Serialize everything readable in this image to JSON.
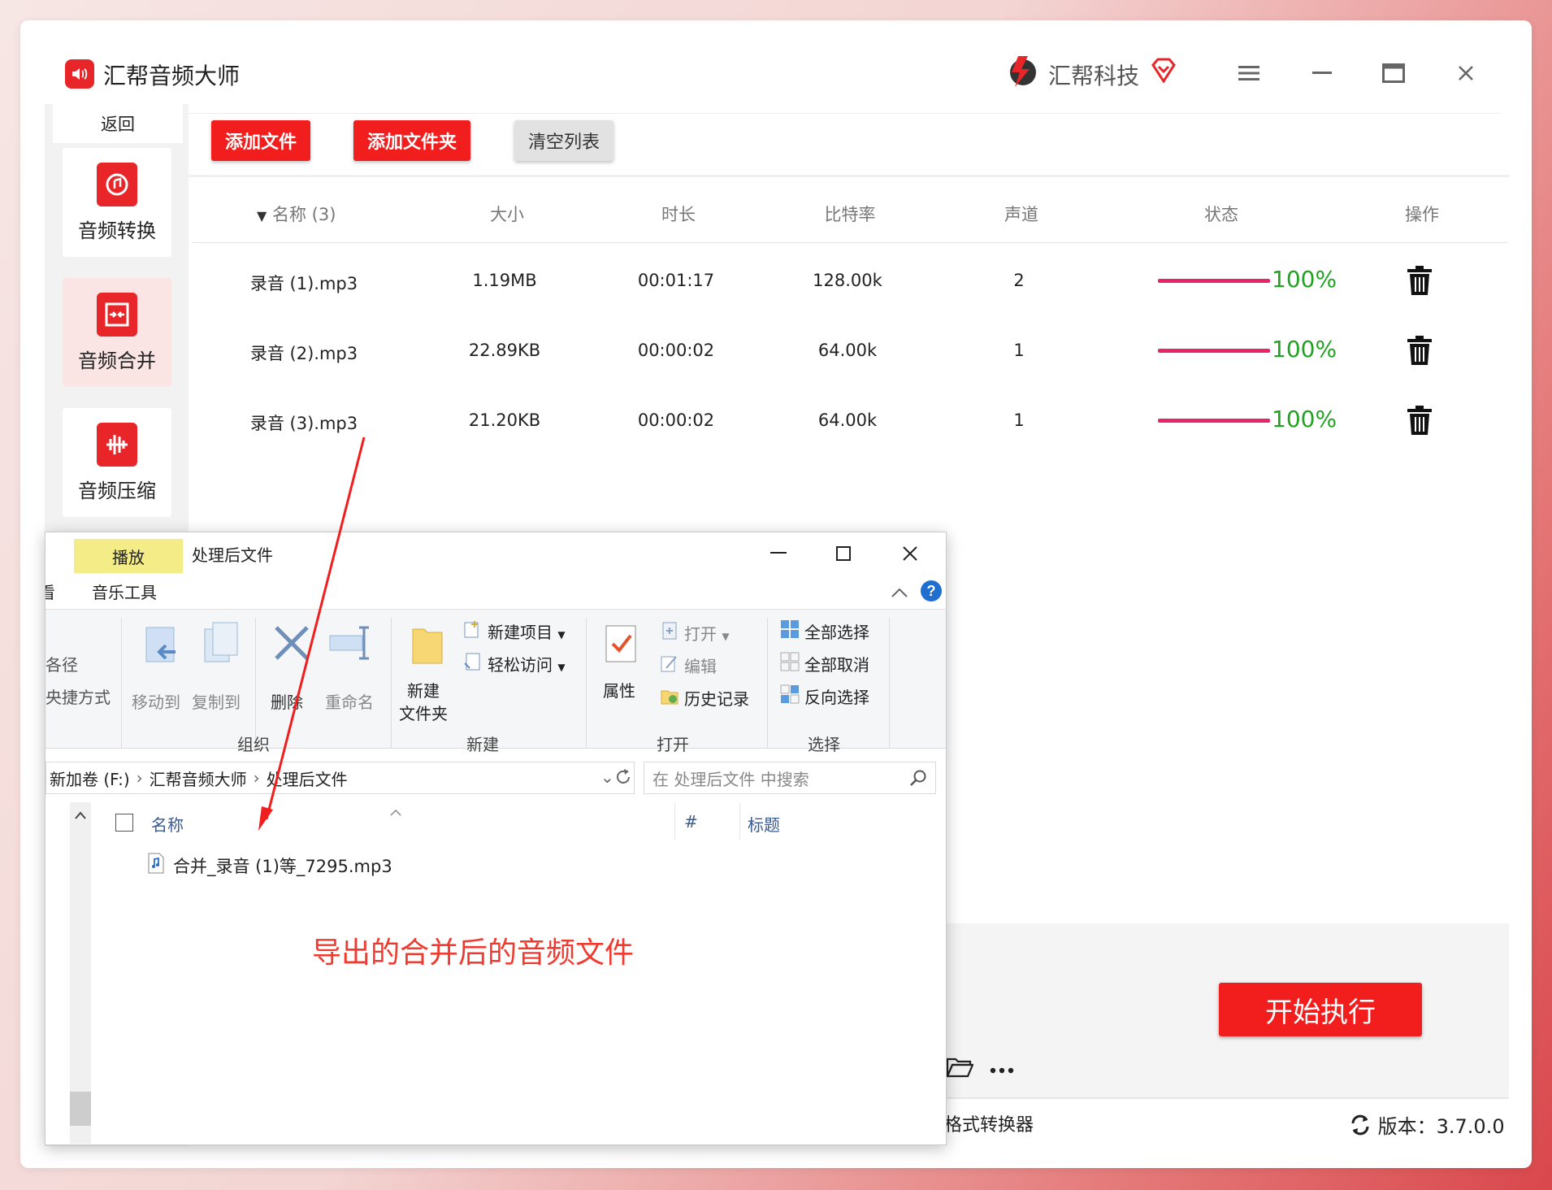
{
  "app": {
    "title": "汇帮音频大师",
    "brand": "汇帮科技",
    "back": "返回"
  },
  "sidebar": {
    "items": [
      {
        "label": "音频转换",
        "icon": "audio-convert-icon"
      },
      {
        "label": "音频合并",
        "icon": "audio-merge-icon"
      },
      {
        "label": "音频压缩",
        "icon": "audio-compress-icon"
      }
    ]
  },
  "toolbar": {
    "add_file": "添加文件",
    "add_folder": "添加文件夹",
    "clear_list": "清空列表"
  },
  "table": {
    "headers": {
      "name": "名称 (3)",
      "size": "大小",
      "duration": "时长",
      "bitrate": "比特率",
      "channels": "声道",
      "status": "状态",
      "action": "操作"
    },
    "rows": [
      {
        "name": "录音 (1).mp3",
        "size": "1.19MB",
        "duration": "00:01:17",
        "bitrate": "128.00k",
        "channels": "2",
        "progress": 100,
        "progress_label": "100%"
      },
      {
        "name": "录音 (2).mp3",
        "size": "22.89KB",
        "duration": "00:00:02",
        "bitrate": "64.00k",
        "channels": "1",
        "progress": 100,
        "progress_label": "100%"
      },
      {
        "name": "录音 (3).mp3",
        "size": "21.20KB",
        "duration": "00:00:02",
        "bitrate": "64.00k",
        "channels": "1",
        "progress": 100,
        "progress_label": "100%"
      }
    ]
  },
  "start_button": "开始执行",
  "footer": {
    "left": "格式转换器",
    "version": "版本：3.7.0.0"
  },
  "explorer": {
    "tab_play": "播放",
    "title": "处理后文件",
    "tab_music_tools": "音乐工具",
    "tab_partial": "看",
    "ribbon": {
      "path": "各径",
      "shortcut": "央捷方式",
      "move_to": "移动到",
      "copy_to": "复制到",
      "delete": "删除",
      "rename": "重命名",
      "group_organize": "组织",
      "new_folder_1": "新建",
      "new_folder_2": "文件夹",
      "new_item": "新建项目",
      "easy_access": "轻松访问",
      "group_new": "新建",
      "properties": "属性",
      "open": "打开",
      "edit": "编辑",
      "history": "历史记录",
      "group_open": "打开",
      "select_all": "全部选择",
      "select_none": "全部取消",
      "invert_selection": "反向选择",
      "group_select": "选择"
    },
    "address": [
      "新加卷 (F:)",
      "汇帮音频大师",
      "处理后文件"
    ],
    "search_placeholder": "在 处理后文件 中搜索",
    "columns": {
      "name": "名称",
      "number": "#",
      "title": "标题"
    },
    "file": "合并_录音 (1)等_7295.mp3",
    "annotation": "导出的合并后的音频文件"
  },
  "colors": {
    "accent": "#f21d1d",
    "progress": "#e8246a",
    "progress_text": "#22a222",
    "annotation": "#f03a2f"
  }
}
